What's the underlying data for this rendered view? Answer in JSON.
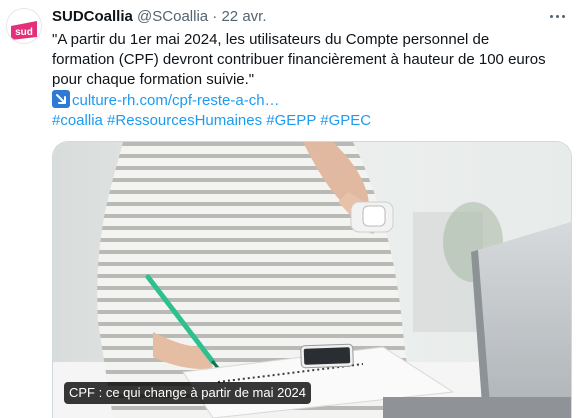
{
  "tweet": {
    "author_name": "SUDCoallia",
    "handle": "@SCoallia",
    "separator": "·",
    "time": "22 avr.",
    "avatar_text": "sud",
    "text_lines": [
      "\"A partir du 1er mai 2024, les utilisateurs du Compte personnel de",
      "formation (CPF) devront contribuer financièrement à hauteur de 100 euros",
      "pour chaque formation suivie.\""
    ],
    "link_text": "culture-rh.com/cpf-reste-a-ch…",
    "hashtags": [
      "#coallia",
      "#RessourcesHumaines",
      "#GEPP",
      "#GPEC"
    ],
    "media_caption": "CPF : ce qui change à partir de mai 2024"
  },
  "colors": {
    "link": "#1d9bf0",
    "brand": "#e4307a"
  },
  "icons": {
    "more": "more-horizontal-icon",
    "link_arrow": "arrow-down-right-icon"
  }
}
